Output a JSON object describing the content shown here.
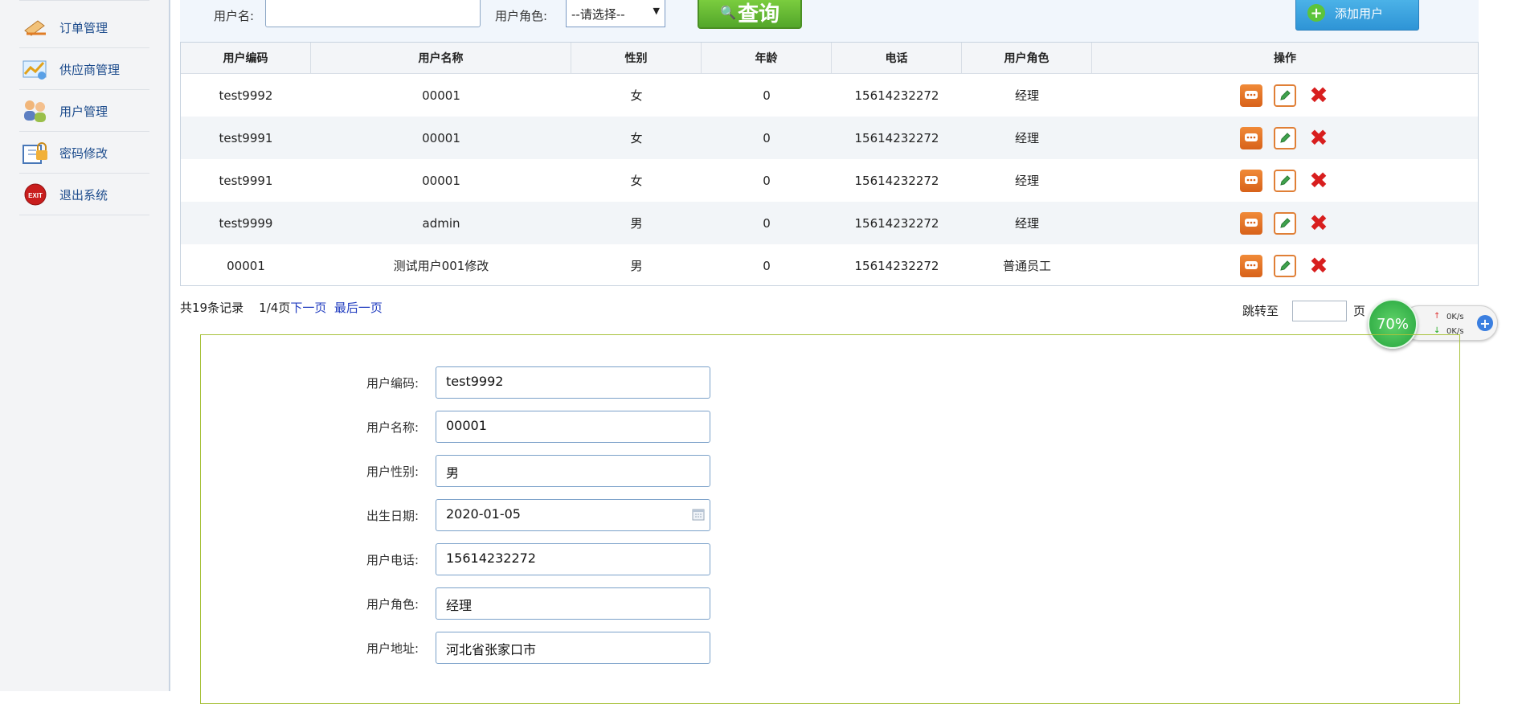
{
  "sidebar": {
    "items": [
      {
        "label": "订单管理",
        "icon": "order-icon"
      },
      {
        "label": "供应商管理",
        "icon": "supplier-icon"
      },
      {
        "label": "用户管理",
        "icon": "users-icon"
      },
      {
        "label": "密码修改",
        "icon": "password-icon"
      },
      {
        "label": "退出系统",
        "icon": "exit-icon"
      }
    ]
  },
  "search": {
    "username_label": "用户名:",
    "username_value": "",
    "role_label": "用户角色:",
    "role_selected": "--请选择--",
    "query_label": "查询",
    "add_label": "添加用户"
  },
  "table": {
    "headers": [
      "用户编码",
      "用户名称",
      "性别",
      "年龄",
      "电话",
      "用户角色",
      "操作"
    ],
    "rows": [
      [
        "test9992",
        "00001",
        "女",
        "0",
        "15614232272",
        "经理"
      ],
      [
        "test9991",
        "00001",
        "女",
        "0",
        "15614232272",
        "经理"
      ],
      [
        "test9991",
        "00001",
        "女",
        "0",
        "15614232272",
        "经理"
      ],
      [
        "test9999",
        "admin",
        "男",
        "0",
        "15614232272",
        "经理"
      ],
      [
        "00001",
        "测试用户001修改",
        "男",
        "0",
        "15614232272",
        "普通员工"
      ]
    ]
  },
  "pagination": {
    "summary": "共19条记录",
    "page": "1/4页",
    "next": "下一页",
    "last": "最后一页",
    "jump_label": "跳转至",
    "jump_suffix": "页"
  },
  "widget": {
    "percent": "70%",
    "up": "0K/s",
    "down": "0K/s"
  },
  "detail": {
    "fields": [
      {
        "label": "用户编码:",
        "value": "test9992"
      },
      {
        "label": "用户名称:",
        "value": "00001"
      },
      {
        "label": "用户性别:",
        "value": "男"
      },
      {
        "label": "出生日期:",
        "value": "2020-01-05"
      },
      {
        "label": "用户电话:",
        "value": "15614232272"
      },
      {
        "label": "用户角色:",
        "value": "经理"
      },
      {
        "label": "用户地址:",
        "value": "河北省张家口市"
      }
    ]
  }
}
